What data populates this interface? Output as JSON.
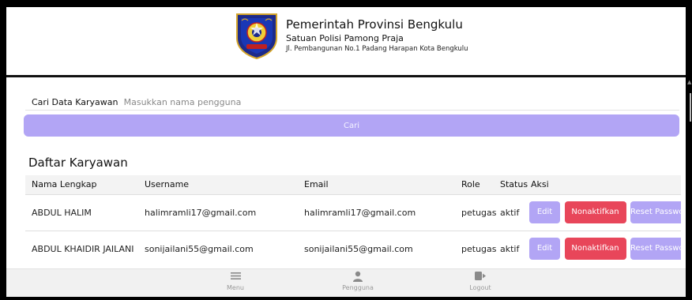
{
  "header": {
    "title": "Pemerintah Provinsi Bengkulu",
    "subtitle": "Satuan Polisi Pamong Praja",
    "address": "Jl. Pembangunan No.1 Padang Harapan Kota Bengkulu",
    "logo_icon": "provincial-emblem"
  },
  "search": {
    "label": "Cari Data Karyawan",
    "placeholder": "Masukkan nama pengguna",
    "value": "",
    "button_label": "Cari"
  },
  "employees": {
    "title": "Daftar Karyawan",
    "columns": [
      "Nama Lengkap",
      "Username",
      "Email",
      "Role",
      "Status",
      "Aksi"
    ],
    "rows": [
      {
        "name": "ABDUL HALIM",
        "username": "halimramli17@gmail.com",
        "email": "halimramli17@gmail.com",
        "role": "petugas",
        "status": "aktif",
        "edit_label": "Edit",
        "deactivate_label": "Nonaktifkan",
        "reset_label": "Reset Password"
      },
      {
        "name": "ABDUL KHAIDIR JAILANI",
        "username": "sonijailani55@gmail.com",
        "email": "sonijailani55@gmail.com",
        "role": "petugas",
        "status": "aktif",
        "edit_label": "Edit",
        "deactivate_label": "Nonaktifkan",
        "reset_label": "Reset Password"
      }
    ]
  },
  "bottom_nav": {
    "items": [
      {
        "label": "Menu",
        "icon": "hamburger-icon"
      },
      {
        "label": "Pengguna",
        "icon": "user-icon"
      },
      {
        "label": "Logout",
        "icon": "logout-icon"
      }
    ]
  },
  "colors": {
    "accent": "#b2a5f5",
    "danger": "#e8465a",
    "nav_bg": "#f1f1f1"
  }
}
